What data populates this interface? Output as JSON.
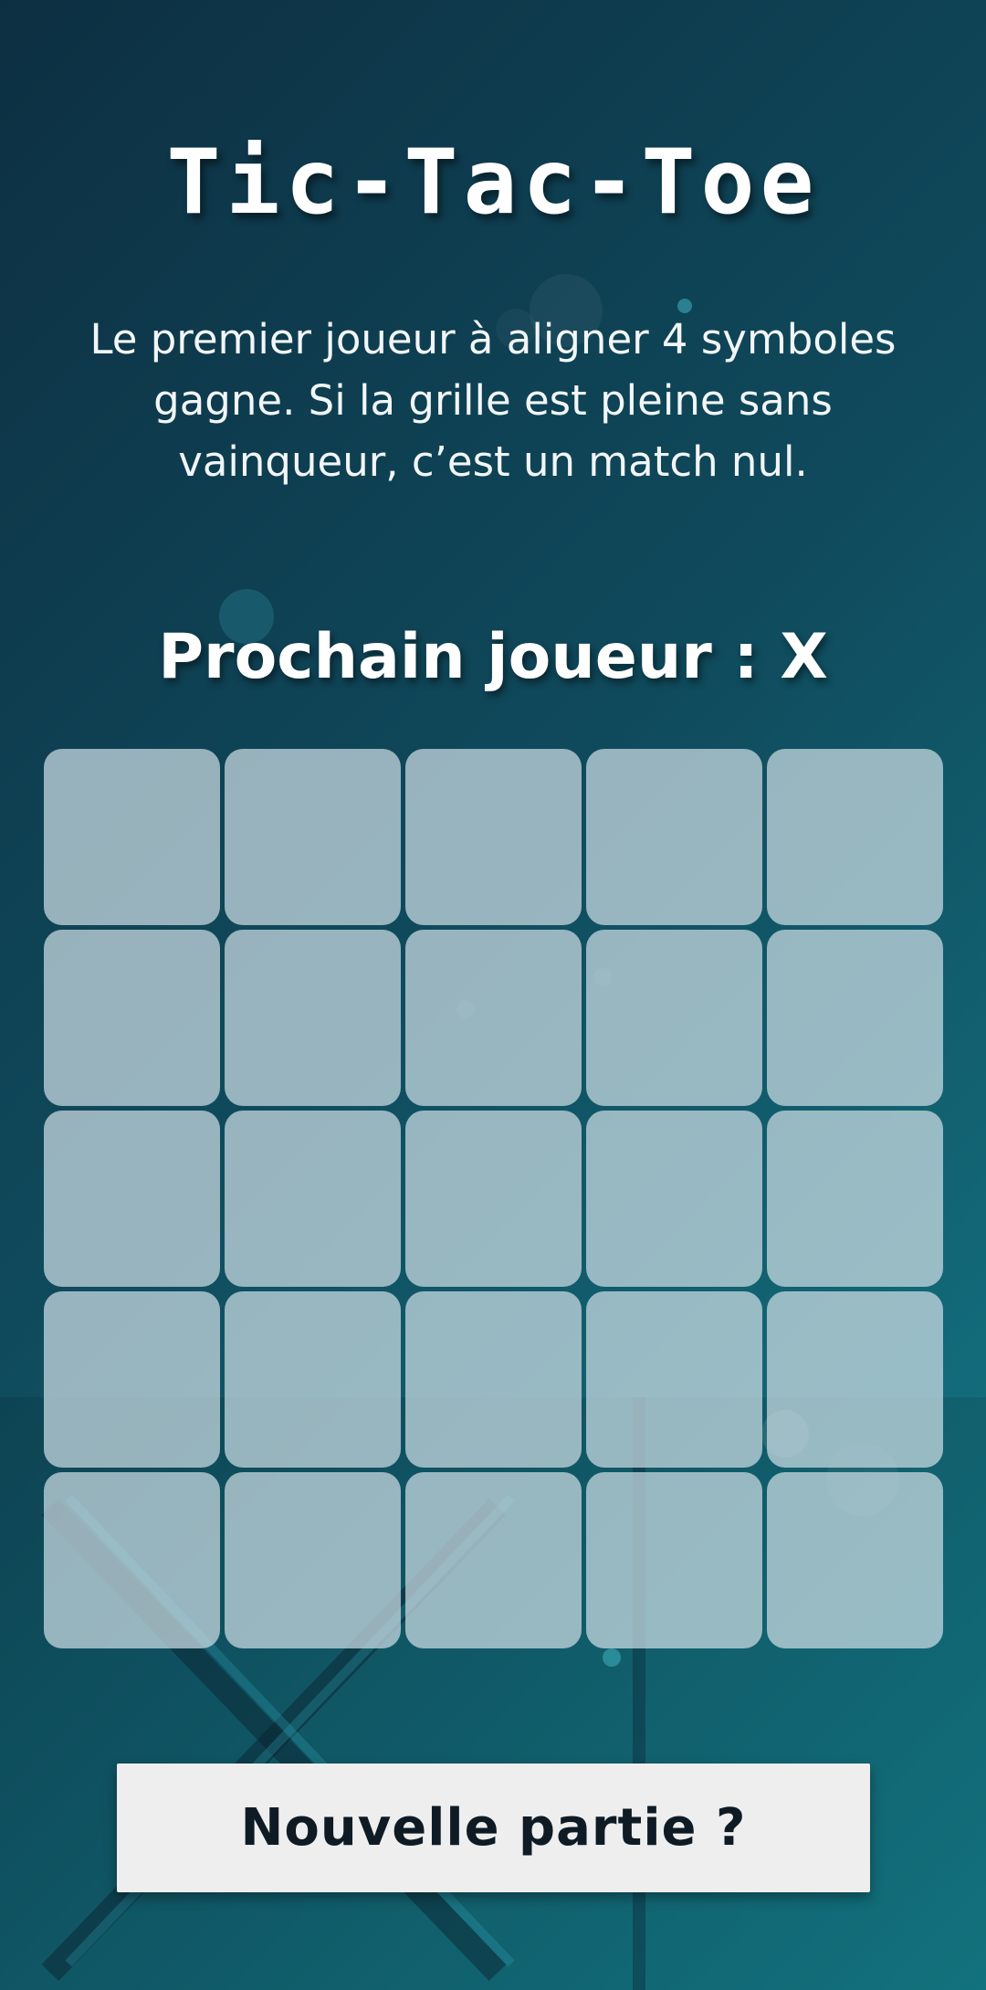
{
  "game": {
    "title": "Tic-Tac-Toe",
    "rules": "Le premier joueur à aligner 4 symboles gagne. Si la grille est pleine sans vainqueur, c’est un match nul.",
    "turn_status": "Prochain joueur : X",
    "new_game_label": "Nouvelle partie ?"
  },
  "board": {
    "rows": 5,
    "columns": 5,
    "cells": [
      [
        "",
        "",
        "",
        "",
        ""
      ],
      [
        "",
        "",
        "",
        "",
        ""
      ],
      [
        "",
        "",
        "",
        "",
        ""
      ],
      [
        "",
        "",
        "",
        "",
        ""
      ],
      [
        "",
        "",
        "",
        "",
        ""
      ]
    ]
  },
  "colors": {
    "background_dark": "#0d2f42",
    "background_light": "#157f8c",
    "cell": "#cddee4",
    "button": "#eeeeee",
    "button_text": "#0f1b24"
  }
}
